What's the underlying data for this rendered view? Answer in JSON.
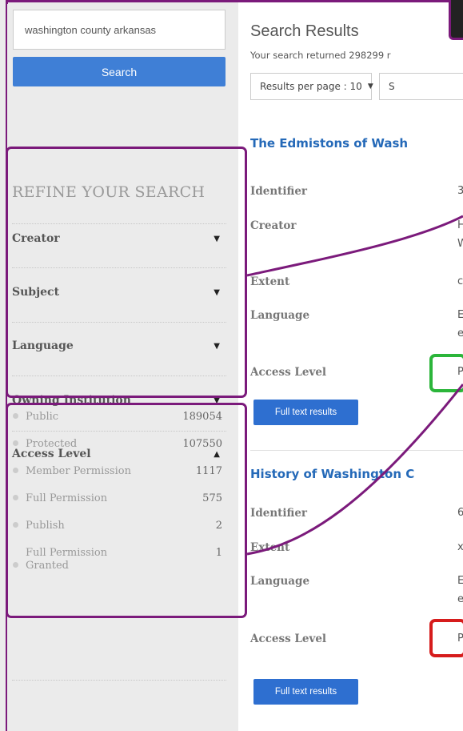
{
  "sidebar": {
    "search_value": "washington county arkansas",
    "search_button": "Search",
    "refine_title": "REFINE YOUR SEARCH",
    "facets": [
      {
        "label": "Creator",
        "caret": "▼"
      },
      {
        "label": "Subject",
        "caret": "▼"
      },
      {
        "label": "Language",
        "caret": "▼"
      },
      {
        "label": "Owning Institution",
        "caret": "▼"
      },
      {
        "label": "Access Level",
        "caret": "▲"
      }
    ],
    "access_levels": [
      {
        "label": "Public",
        "count": "189054"
      },
      {
        "label": "Protected",
        "count": "107550"
      },
      {
        "label": "Member Permission",
        "count": "1117"
      },
      {
        "label": "Full Permission",
        "count": "575"
      },
      {
        "label": "Publish",
        "count": "2"
      },
      {
        "label": "Full Permission Granted",
        "count": "1"
      }
    ]
  },
  "main": {
    "title": "Search Results",
    "summary": "Your search returned 298299 r",
    "per_page": "Results per page : 10",
    "per_page_caret": "▼",
    "sort_partial": "S",
    "results": [
      {
        "title": "The Edmistons of Wash",
        "fields": [
          {
            "label": "Identifier",
            "value": "3"
          },
          {
            "label": "Creator",
            "value": "H",
            "value2": "W"
          },
          {
            "label": "Extent",
            "value": "c"
          },
          {
            "label": "Language",
            "value": "E",
            "value2": "e"
          },
          {
            "label": "Access Level",
            "value": "P"
          }
        ],
        "button": "Full text results"
      },
      {
        "title": "History of Washington C",
        "fields": [
          {
            "label": "Identifier",
            "value": "6"
          },
          {
            "label": "Extent",
            "value": "x"
          },
          {
            "label": "Language",
            "value": "E",
            "value2": "e"
          },
          {
            "label": "Access Level",
            "value": "P"
          }
        ],
        "button": "Full text results"
      }
    ]
  },
  "colors": {
    "annotation_purple": "#7b1a7b",
    "annotation_green": "#2bb53a",
    "annotation_red": "#d61c1c",
    "link_blue": "#2469b8",
    "button_blue": "#2e6fd0"
  }
}
